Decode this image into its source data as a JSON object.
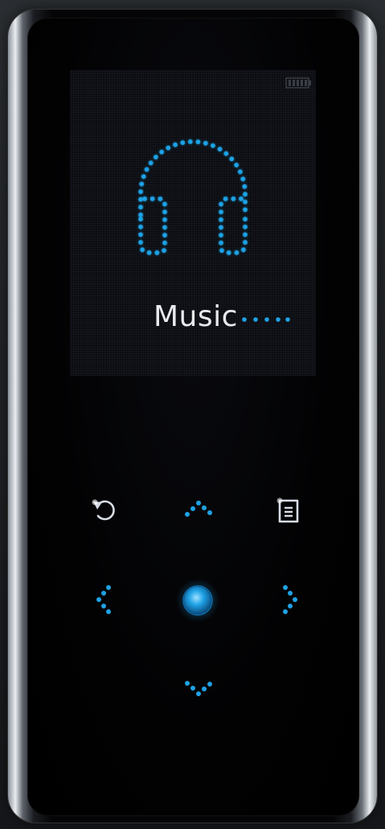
{
  "screen": {
    "app_label": "Music"
  },
  "icons": {
    "battery": "battery-icon",
    "headphones": "headphones-icon",
    "back": "back-icon",
    "menu": "menu-icon",
    "up": "chevron-up-icon",
    "down": "chevron-down-icon",
    "left": "chevron-left-icon",
    "right": "chevron-right-icon",
    "select": "select-icon"
  },
  "colors": {
    "accent": "#1fa2e6",
    "accent_bright": "#62c8ff",
    "text": "#e8eaee",
    "bezel": "#050507"
  }
}
